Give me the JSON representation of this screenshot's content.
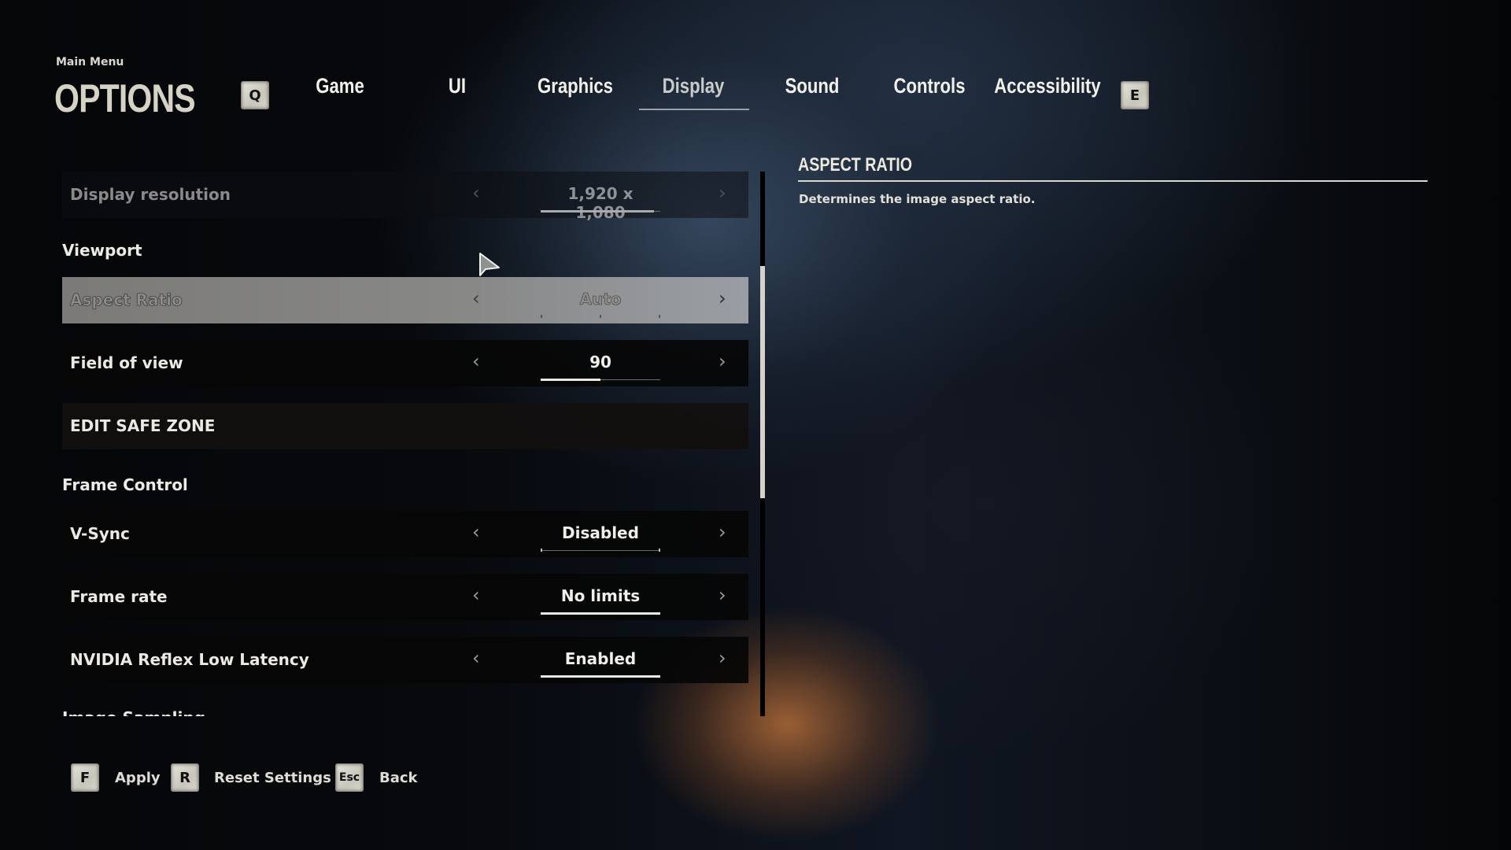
{
  "header": {
    "breadcrumb": "Main Menu",
    "title": "OPTIONS",
    "prev_key": "Q",
    "next_key": "E",
    "tabs": [
      {
        "label": "Game",
        "active": false
      },
      {
        "label": "UI",
        "active": false
      },
      {
        "label": "Graphics",
        "active": false
      },
      {
        "label": "Display",
        "active": true
      },
      {
        "label": "Sound",
        "active": false
      },
      {
        "label": "Controls",
        "active": false
      },
      {
        "label": "Accessibility",
        "active": false
      }
    ]
  },
  "settings": {
    "display_resolution": {
      "label": "Display resolution",
      "value": "1,920 x 1,080",
      "state": "disabled",
      "slider_fill": 0.95
    },
    "viewport_heading": "Viewport",
    "aspect_ratio": {
      "label": "Aspect Ratio",
      "value": "Auto",
      "state": "focused"
    },
    "field_of_view": {
      "label": "Field of view",
      "value": "90",
      "slider_fill": 0.5
    },
    "edit_safe_zone": {
      "label": "EDIT SAFE ZONE"
    },
    "frame_control_heading": "Frame Control",
    "vsync": {
      "label": "V-Sync",
      "value": "Disabled",
      "slider_fill": 0.0
    },
    "frame_rate": {
      "label": "Frame rate",
      "value": "No limits",
      "slider_fill": 1.0
    },
    "nvidia_reflex": {
      "label": "NVIDIA Reflex Low Latency",
      "value": "Enabled",
      "slider_fill": 1.0
    },
    "next_heading_clipped": "Image Sampling"
  },
  "scrollbar": {
    "position_fraction": 0.17,
    "visible_fraction": 0.43
  },
  "info_panel": {
    "title": "ASPECT RATIO",
    "description": "Determines the image aspect ratio."
  },
  "footer": {
    "actions": [
      {
        "key": "F",
        "label": "Apply"
      },
      {
        "key": "R",
        "label": "Reset Settings"
      },
      {
        "key": "Esc",
        "label": "Back"
      }
    ]
  },
  "icons": {
    "chevron_left": "‹",
    "chevron_right": "›"
  }
}
